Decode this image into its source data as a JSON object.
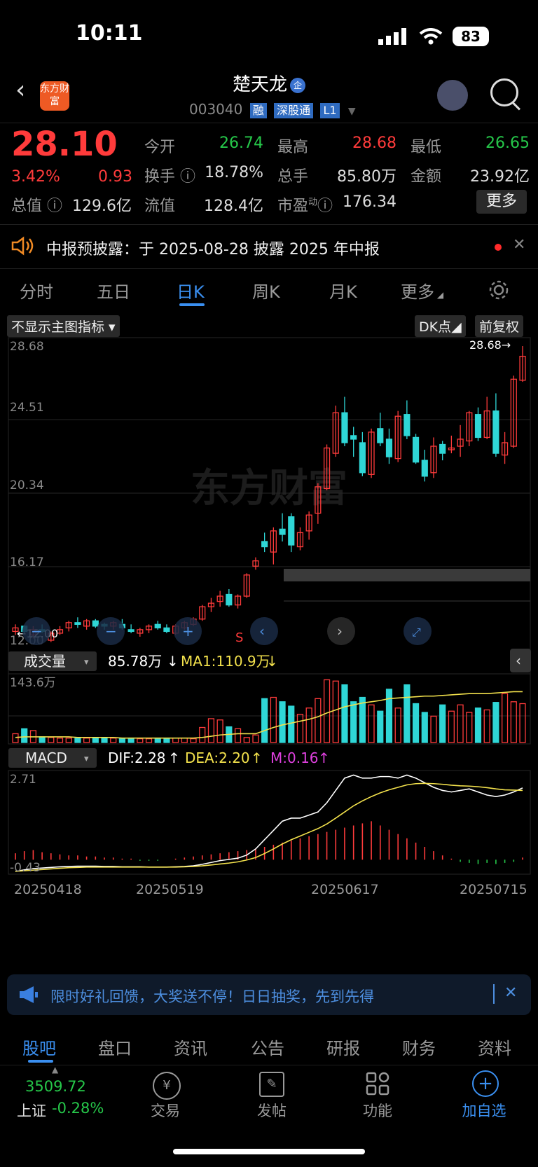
{
  "status_bar": {
    "time": "10:11",
    "battery": "83"
  },
  "header": {
    "name": "楚天龙",
    "badge": "企",
    "code": "003040",
    "tags": [
      "融",
      "深股通",
      "L1"
    ],
    "logo_text": "东方财富"
  },
  "quote": {
    "price": "28.10",
    "change_pct": "3.42%",
    "change": "0.93",
    "fields": [
      {
        "label": "今开",
        "value": "26.74",
        "color": "green"
      },
      {
        "label": "最高",
        "value": "28.68",
        "color": "red"
      },
      {
        "label": "最低",
        "value": "26.65",
        "color": "green"
      },
      {
        "label": "换手",
        "value": "18.78%",
        "color": ""
      },
      {
        "label": "总手",
        "value": "85.80万",
        "color": ""
      },
      {
        "label": "金额",
        "value": "23.92亿",
        "color": ""
      },
      {
        "label": "总值",
        "value": "129.6亿",
        "color": ""
      },
      {
        "label": "流值",
        "value": "128.4亿",
        "color": ""
      },
      {
        "label": "市盈",
        "value": "176.34",
        "color": "",
        "sup": "动"
      }
    ],
    "more_button": "更多"
  },
  "notice": {
    "text": "中报预披露：于 2025-08-28 披露 2025 年中报"
  },
  "tabs": [
    "分时",
    "五日",
    "日K",
    "周K",
    "月K",
    "更多"
  ],
  "active_tab": "日K",
  "chart_toolbar": {
    "indicator_select": "不显示主图指标",
    "dk_button": "DK点",
    "adjust_button": "前复权"
  },
  "main_chart": {
    "y_ticks": [
      "28.68",
      "24.51",
      "20.34",
      "16.17",
      "12.00"
    ],
    "high_label": "28.68→",
    "low_label": "←12.00",
    "sell_marker": "S"
  },
  "volume": {
    "select": "成交量",
    "value": "85.78万",
    "ma1": "MA1:110.9万",
    "top_label": "143.6万"
  },
  "macd": {
    "select": "MACD",
    "dif": "DIF:2.28",
    "dea": "DEA:2.20",
    "m": "M:0.16",
    "top_label": "2.71",
    "bottom_label": "-0.43"
  },
  "x_dates": [
    "20250418",
    "20250519",
    "20250617",
    "20250715"
  ],
  "chart_data": {
    "type": "candlestick",
    "y_range": [
      12.0,
      28.68
    ],
    "watermark": "东方财富",
    "candles": [
      [
        12.5,
        12.9,
        12.3,
        12.7
      ],
      [
        12.8,
        12.85,
        12.4,
        12.5
      ],
      [
        12.3,
        12.8,
        12.1,
        12.6
      ],
      [
        12.6,
        12.9,
        12.4,
        12.5
      ],
      [
        12.0,
        12.5,
        11.9,
        12.4
      ],
      [
        12.4,
        12.8,
        12.3,
        12.6
      ],
      [
        12.7,
        13.1,
        12.5,
        13.0
      ],
      [
        13.0,
        13.3,
        12.7,
        12.9
      ],
      [
        12.8,
        13.2,
        12.6,
        13.1
      ],
      [
        13.1,
        13.2,
        12.7,
        12.8
      ],
      [
        12.9,
        13.0,
        12.6,
        12.8
      ],
      [
        12.8,
        13.1,
        12.6,
        13.0
      ],
      [
        12.9,
        13.2,
        12.6,
        12.7
      ],
      [
        12.6,
        12.9,
        12.4,
        12.5
      ],
      [
        12.4,
        12.7,
        12.2,
        12.6
      ],
      [
        12.6,
        12.9,
        12.4,
        12.8
      ],
      [
        12.9,
        13.1,
        12.6,
        12.7
      ],
      [
        12.7,
        12.9,
        12.4,
        12.5
      ],
      [
        12.4,
        12.9,
        12.3,
        12.8
      ],
      [
        12.7,
        13.1,
        12.6,
        13.0
      ],
      [
        12.9,
        13.3,
        12.8,
        13.2
      ],
      [
        13.2,
        14.0,
        13.1,
        13.9
      ],
      [
        13.9,
        14.4,
        13.6,
        14.1
      ],
      [
        14.2,
        14.8,
        13.9,
        14.5
      ],
      [
        14.6,
        14.9,
        13.9,
        14.0
      ],
      [
        14.0,
        14.6,
        13.8,
        14.5
      ],
      [
        14.5,
        15.8,
        14.4,
        15.7
      ],
      [
        16.2,
        16.7,
        16.0,
        16.5
      ],
      [
        17.6,
        18.1,
        17.0,
        17.3
      ],
      [
        17.0,
        18.4,
        16.3,
        18.2
      ],
      [
        18.3,
        19.2,
        17.6,
        18.0
      ],
      [
        19.0,
        19.2,
        17.0,
        17.4
      ],
      [
        17.3,
        18.4,
        17.1,
        18.1
      ],
      [
        18.2,
        19.3,
        17.7,
        19.1
      ],
      [
        19.2,
        20.9,
        18.6,
        20.7
      ],
      [
        20.6,
        23.1,
        20.5,
        22.9
      ],
      [
        22.6,
        25.3,
        22.4,
        24.9
      ],
      [
        24.9,
        25.8,
        23.0,
        23.2
      ],
      [
        23.6,
        24.1,
        22.4,
        23.4
      ],
      [
        23.2,
        23.8,
        21.3,
        21.5
      ],
      [
        21.4,
        24.0,
        21.2,
        23.8
      ],
      [
        24.0,
        24.9,
        23.0,
        23.2
      ],
      [
        23.4,
        24.0,
        22.0,
        22.4
      ],
      [
        22.3,
        25.0,
        22.1,
        24.7
      ],
      [
        24.8,
        25.6,
        23.4,
        23.6
      ],
      [
        23.5,
        23.7,
        22.0,
        22.1
      ],
      [
        22.2,
        22.8,
        21.0,
        21.3
      ],
      [
        21.5,
        23.5,
        21.2,
        23.0
      ],
      [
        23.1,
        23.3,
        22.2,
        22.6
      ],
      [
        22.8,
        23.6,
        22.6,
        22.9
      ],
      [
        23.0,
        24.2,
        22.4,
        23.4
      ],
      [
        23.3,
        25.0,
        23.0,
        24.9
      ],
      [
        24.8,
        25.2,
        23.3,
        23.5
      ],
      [
        23.5,
        25.8,
        23.4,
        25.0
      ],
      [
        25.0,
        26.0,
        22.4,
        22.6
      ],
      [
        22.5,
        23.8,
        22.0,
        23.2
      ],
      [
        23.0,
        27.0,
        22.9,
        26.8
      ],
      [
        26.74,
        28.68,
        26.65,
        28.1
      ]
    ],
    "volumes": [
      14,
      22,
      19,
      9,
      8,
      7,
      7,
      7,
      7,
      7,
      7,
      7,
      7,
      6,
      6,
      6,
      7,
      7,
      7,
      7,
      6,
      24,
      38,
      36,
      25,
      22,
      8,
      12,
      70,
      72,
      65,
      58,
      45,
      55,
      70,
      100,
      98,
      92,
      65,
      72,
      60,
      50,
      85,
      55,
      92,
      62,
      48,
      42,
      60,
      50,
      60,
      48,
      55,
      52,
      64,
      78,
      65,
      62
    ],
    "volume_ma": [
      8,
      9,
      9,
      9,
      9,
      9,
      9,
      8,
      8,
      8,
      8,
      8,
      7,
      7,
      7,
      7,
      7,
      7,
      7,
      7,
      7,
      8,
      10,
      12,
      13,
      14,
      14,
      14,
      19,
      24,
      28,
      31,
      34,
      37,
      41,
      47,
      52,
      57,
      60,
      63,
      65,
      67,
      70,
      71,
      72,
      73,
      74,
      74,
      75,
      76,
      77,
      78,
      78,
      78,
      79,
      80,
      81,
      81
    ],
    "macd_hist": [
      6,
      8,
      9,
      7,
      6,
      5,
      4,
      4,
      3,
      3,
      2,
      2,
      1,
      1,
      -1,
      -1,
      -1,
      0,
      1,
      2,
      3,
      4,
      5,
      6,
      7,
      8,
      9,
      10,
      12,
      14,
      16,
      18,
      20,
      22,
      24,
      26,
      28,
      30,
      32,
      34,
      36,
      32,
      28,
      24,
      20,
      16,
      12,
      8,
      4,
      1,
      -2,
      -3,
      -4,
      -3,
      -4,
      -3,
      -2,
      2
    ],
    "dif": [
      -0.43,
      -0.38,
      -0.34,
      -0.32,
      -0.3,
      -0.28,
      -0.27,
      -0.26,
      -0.26,
      -0.26,
      -0.27,
      -0.27,
      -0.28,
      -0.28,
      -0.28,
      -0.29,
      -0.29,
      -0.29,
      -0.28,
      -0.27,
      -0.25,
      -0.2,
      -0.14,
      -0.08,
      -0.04,
      0.0,
      0.1,
      0.3,
      0.6,
      0.9,
      1.2,
      1.3,
      1.3,
      1.4,
      1.5,
      1.8,
      2.2,
      2.6,
      2.7,
      2.6,
      2.6,
      2.65,
      2.65,
      2.6,
      2.7,
      2.6,
      2.45,
      2.3,
      2.2,
      2.15,
      2.2,
      2.25,
      2.15,
      2.05,
      2.0,
      2.05,
      2.15,
      2.28
    ],
    "dea": [
      -0.43,
      -0.41,
      -0.39,
      -0.37,
      -0.35,
      -0.33,
      -0.31,
      -0.3,
      -0.29,
      -0.29,
      -0.29,
      -0.29,
      -0.29,
      -0.29,
      -0.29,
      -0.29,
      -0.29,
      -0.29,
      -0.29,
      -0.28,
      -0.27,
      -0.25,
      -0.22,
      -0.19,
      -0.16,
      -0.12,
      -0.06,
      0.02,
      0.15,
      0.3,
      0.46,
      0.6,
      0.72,
      0.84,
      0.96,
      1.11,
      1.3,
      1.5,
      1.7,
      1.86,
      2.0,
      2.12,
      2.22,
      2.3,
      2.38,
      2.42,
      2.43,
      2.42,
      2.4,
      2.37,
      2.35,
      2.34,
      2.32,
      2.29,
      2.25,
      2.22,
      2.21,
      2.2
    ]
  },
  "promo": {
    "text": "限时好礼回馈，大奖送不停！日日抽奖，先到先得"
  },
  "bottom_tabs": [
    "股吧",
    "盘口",
    "资讯",
    "公告",
    "研报",
    "财务",
    "资料"
  ],
  "active_bottom_tab": "股吧",
  "dock": {
    "index_value": "3509.72",
    "index_name": "上证",
    "index_change": "-0.28%",
    "items": [
      "交易",
      "发帖",
      "功能",
      "加自选"
    ]
  },
  "colors": {
    "up": "#ff3b3b",
    "down": "#2fd6d6",
    "accent": "#3a8ff0",
    "ma": "#f2e14c",
    "macd_m": "#e040e0"
  }
}
